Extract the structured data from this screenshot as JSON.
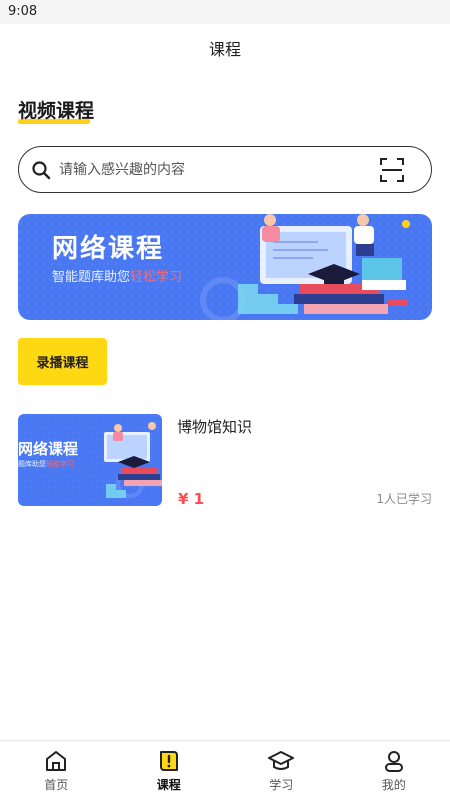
{
  "status_bar": {
    "time": "9:08"
  },
  "header": {
    "title": "课程"
  },
  "section": {
    "title": "视频课程"
  },
  "search": {
    "placeholder": "请输入感兴趣的内容"
  },
  "banner": {
    "title": "网络课程",
    "subtitle_prefix": "智能题库助您",
    "subtitle_highlight": "轻松学习"
  },
  "category": {
    "label": "录播课程"
  },
  "courses": [
    {
      "thumb_title": "网络课程",
      "thumb_sub_prefix": "题库助您",
      "thumb_sub_highlight": "轻松学习",
      "name": "博物馆知识",
      "price": "¥ 1",
      "learners": "1人已学习"
    }
  ],
  "tabs": [
    {
      "label": "首页",
      "icon": "home-icon",
      "active": false
    },
    {
      "label": "课程",
      "icon": "book-icon",
      "active": true
    },
    {
      "label": "学习",
      "icon": "graduation-cap-icon",
      "active": false
    },
    {
      "label": "我的",
      "icon": "user-icon",
      "active": false
    }
  ],
  "colors": {
    "accent_yellow": "#ffd814",
    "banner_blue": "#4a78f2",
    "price_red": "#ff4d4f",
    "highlight_red": "#ff6a6a"
  }
}
